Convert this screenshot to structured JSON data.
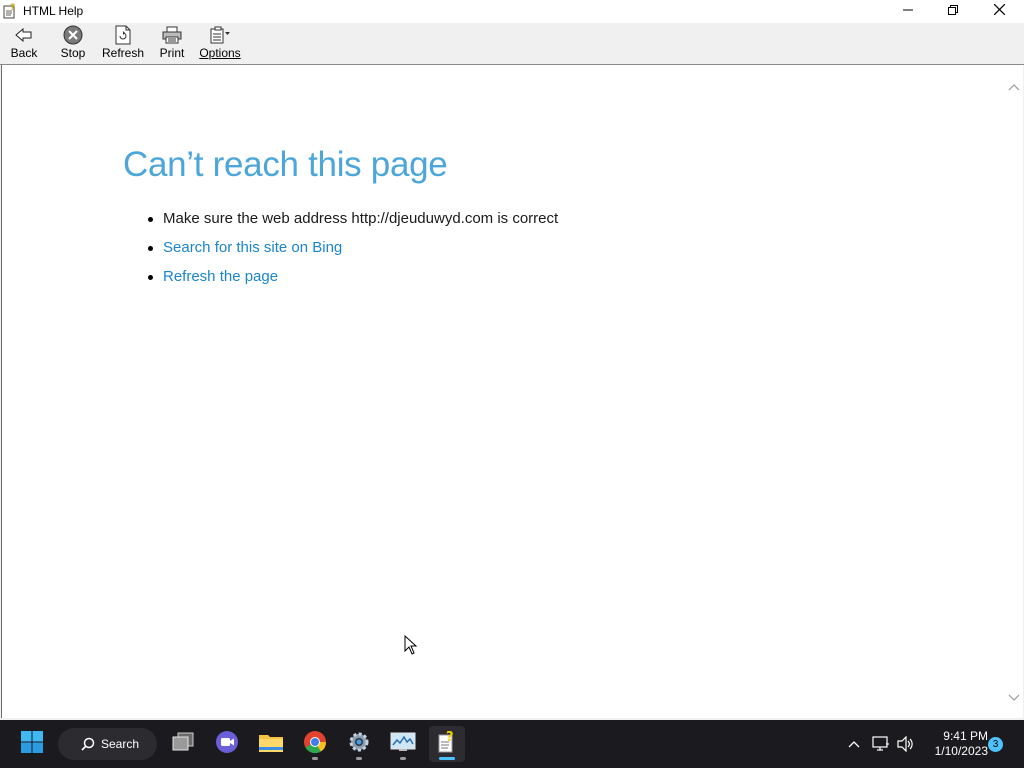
{
  "window": {
    "title": "HTML Help",
    "controls": {
      "minimize_icon": "minimize-icon",
      "maximize_icon": "restore-icon",
      "close_icon": "close-icon"
    }
  },
  "toolbar": {
    "buttons": [
      {
        "label": "Back",
        "icon": "back-arrow-icon"
      },
      {
        "label": "Stop",
        "icon": "stop-icon"
      },
      {
        "label": "Refresh",
        "icon": "refresh-icon"
      },
      {
        "label": "Print",
        "icon": "printer-icon"
      },
      {
        "label": "Options",
        "icon": "options-icon"
      }
    ]
  },
  "error_page": {
    "title": "Can’t reach this page",
    "items": [
      {
        "text": "Make sure the web address http://djeuduwyd.com is correct",
        "is_link": false
      },
      {
        "text": "Search for this site on Bing",
        "is_link": true
      },
      {
        "text": "Refresh the page",
        "is_link": true
      }
    ],
    "title_color": "#4ca7d8",
    "link_color": "#1a86c8"
  },
  "taskbar": {
    "search_label": "Search",
    "apps": [
      {
        "name": "start",
        "icon": "windows-logo-icon"
      },
      {
        "name": "task-view",
        "icon": "task-view-icon"
      },
      {
        "name": "teams",
        "icon": "video-chat-icon"
      },
      {
        "name": "file-explorer",
        "icon": "folder-icon"
      },
      {
        "name": "chrome",
        "icon": "chrome-icon"
      },
      {
        "name": "settings",
        "icon": "gear-icon"
      },
      {
        "name": "resource-monitor",
        "icon": "monitor-chart-icon"
      },
      {
        "name": "html-help",
        "icon": "help-file-icon"
      }
    ],
    "clock": {
      "time": "9:41 PM",
      "date": "1/10/2023"
    },
    "notification_count": "3",
    "accent_color": "#4cc2ff"
  }
}
